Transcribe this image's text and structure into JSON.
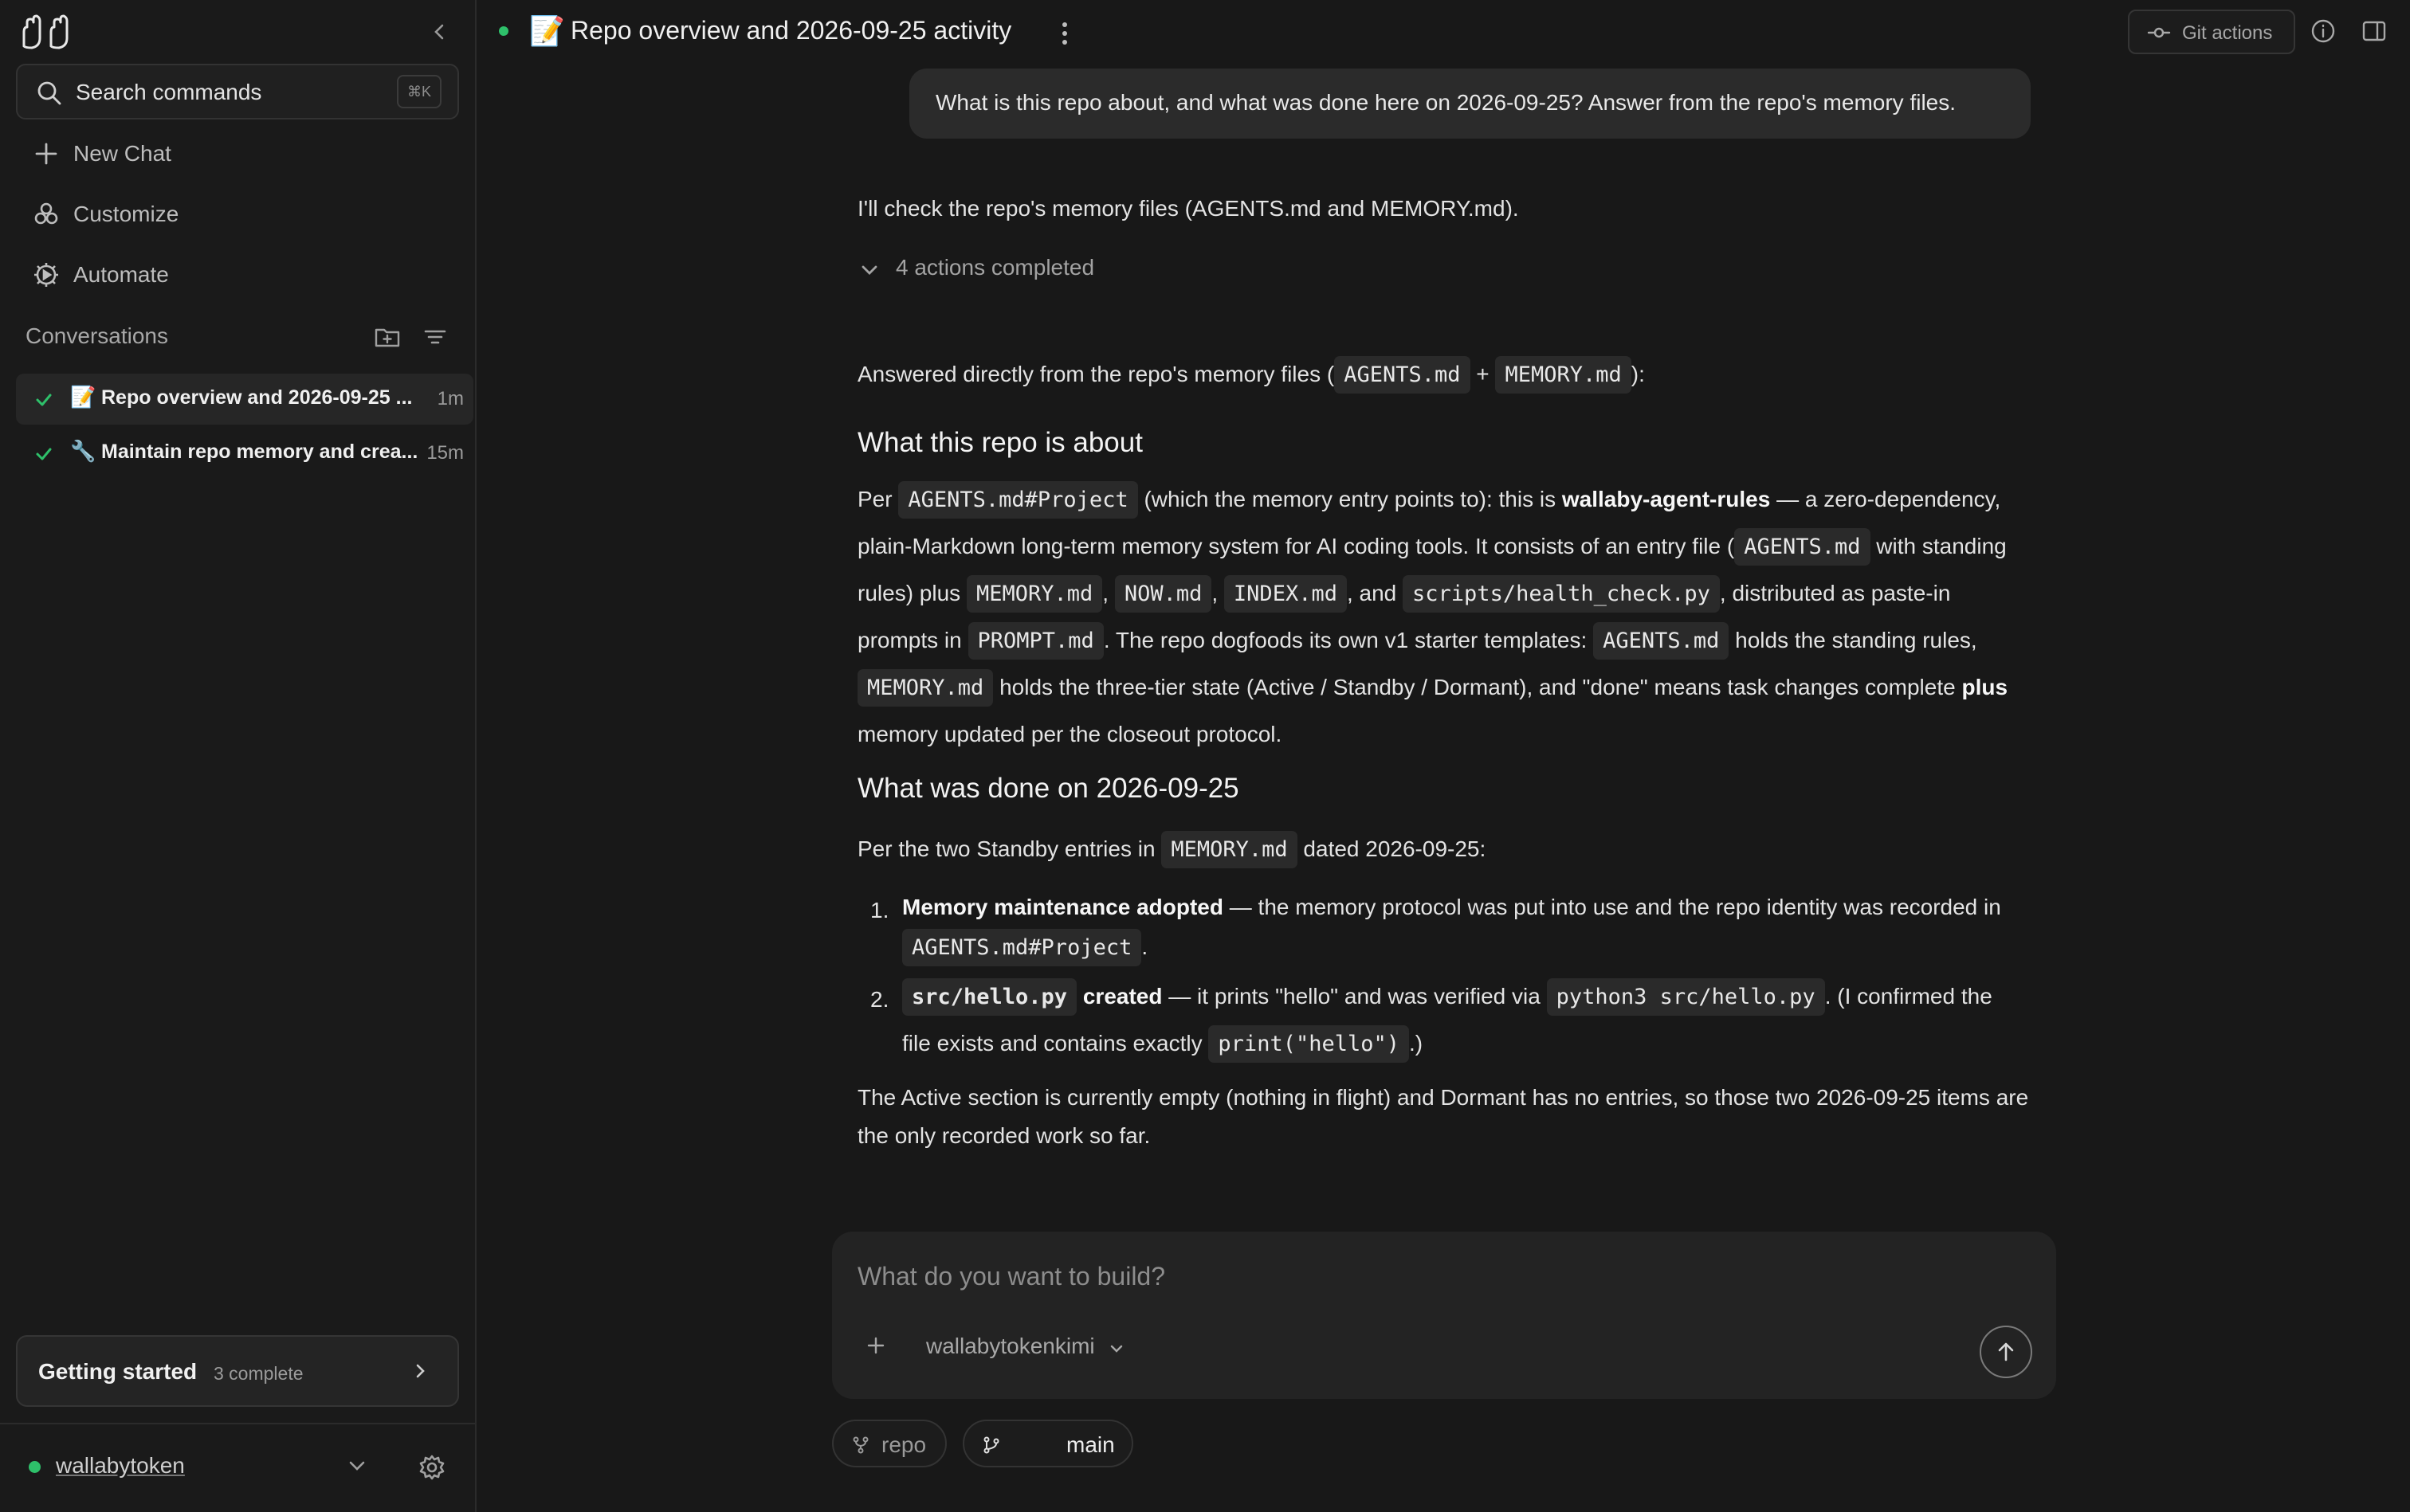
{
  "sidebar": {
    "search_label": "Search commands",
    "search_shortcut": "⌘K",
    "nav": [
      {
        "label": "New Chat",
        "icon": "plus-icon"
      },
      {
        "label": "Customize",
        "icon": "customize-icon"
      },
      {
        "label": "Automate",
        "icon": "automate-icon"
      }
    ],
    "conversations_title": "Conversations",
    "conversations": [
      {
        "emoji": "📝",
        "title": "Repo overview and 2026-09-25 ...",
        "time": "1m",
        "active": true
      },
      {
        "emoji": "🔧",
        "title": "Maintain repo memory and crea...",
        "time": "15m",
        "active": false
      }
    ],
    "getting_started": {
      "title": "Getting started",
      "status": "3 complete"
    },
    "user": {
      "name": "wallabytoken",
      "status_color": "#2ec06a"
    }
  },
  "header": {
    "emoji": "📝",
    "title": "Repo overview and 2026-09-25 activity",
    "git_actions_label": "Git actions"
  },
  "chat": {
    "user_message": "What is this repo about, and what was done here on 2026-09-25? Answer from the repo's memory files.",
    "assistant_intro": "I'll check the repo's memory files (AGENTS.md and MEMORY.md).",
    "actions_label": "4 actions completed",
    "answer_lead": {
      "a": "Answered directly from the repo's memory files (",
      "code1": "AGENTS.md",
      "plus": "+",
      "code2": "MEMORY.md",
      "end": "):"
    },
    "h_about": "What this repo is about",
    "about": {
      "t1": "Per ",
      "c1": "AGENTS.md#Project",
      "t2": " (which the memory entry points to): this is ",
      "b1": "wallaby-agent-rules",
      "t3": " — a zero-dependency, plain-Markdown long-term memory system for AI coding tools. It consists of an entry file (",
      "c2": "AGENTS.md",
      "t4": " with standing rules) plus ",
      "c3": "MEMORY.md",
      "t5": ", ",
      "c4": "NOW.md",
      "t6": ", ",
      "c5": "INDEX.md",
      "t7": ", and ",
      "c6": "scripts/health_check.py",
      "t8": ", distributed as paste-in prompts in ",
      "c7": "PROMPT.md",
      "t9": ". The repo dogfoods its own v1 starter templates: ",
      "c8": "AGENTS.md",
      "t10": " holds the standing rules, ",
      "c9": "MEMORY.md",
      "t11": " holds the three-tier state (Active / Standby / Dormant), and \"done\" means task changes complete ",
      "b2": "plus",
      "t12": " memory updated per the closeout protocol."
    },
    "h_done": "What was done on 2026-09-25",
    "done_intro": {
      "t1": "Per the two Standby entries in ",
      "c1": "MEMORY.md",
      "t2": " dated 2026-09-25:"
    },
    "item1": {
      "num": "1.",
      "b": "Memory maintenance adopted",
      "t1": " — the memory protocol was put into use and the repo identity was recorded in ",
      "c1": "AGENTS.md#Project",
      "t2": "."
    },
    "item2": {
      "num": "2.",
      "c0": "src/hello.py",
      "b": " created",
      "t1": " — it prints \"hello\" and was verified via ",
      "c1": "python3 src/hello.py",
      "t2": ". (I confirmed the file exists and contains exactly ",
      "c2": "print(\"hello\")",
      "t3": ".)"
    },
    "closing": "The Active section is currently empty (nothing in flight) and Dormant has no entries, so those two 2026-09-25 items are the only recorded work so far."
  },
  "composer": {
    "placeholder": "What do you want to build?",
    "model": "wallabytokenkimi",
    "repo_label": "repo",
    "branch_label": "main"
  },
  "colors": {
    "accent_green": "#2ec06a",
    "background": "#181818",
    "sidebar": "#1a1a1a"
  }
}
